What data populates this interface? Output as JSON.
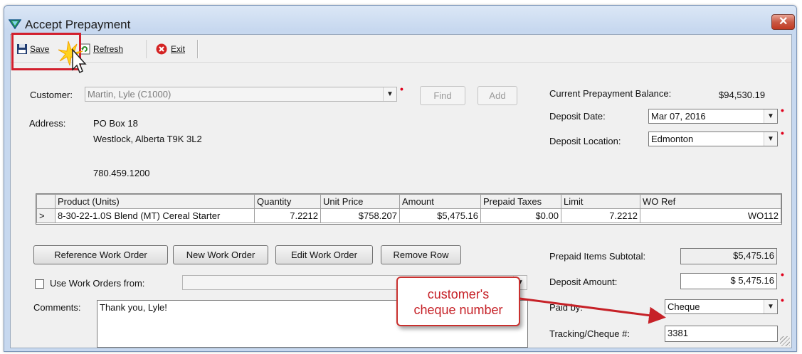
{
  "window": {
    "title": "Accept Prepayment",
    "close_symbol": "✕"
  },
  "toolbar": {
    "save_label": "Save",
    "refresh_label": "Refresh",
    "exit_label": "Exit"
  },
  "customer": {
    "label": "Customer:",
    "value": "Martin, Lyle (C1000)",
    "find_label": "Find",
    "add_label": "Add"
  },
  "address": {
    "label": "Address:",
    "line1": "PO Box 18",
    "line2": "Westlock, Alberta T9K 3L2",
    "phone": "780.459.1200"
  },
  "balance": {
    "label": "Current Prepayment Balance:",
    "value": "$94,530.19"
  },
  "deposit": {
    "date_label": "Deposit Date:",
    "date_value": "Mar 07, 2016",
    "location_label": "Deposit Location:",
    "location_value": "Edmonton"
  },
  "table": {
    "columns": [
      "Product (Units)",
      "Quantity",
      "Unit Price",
      "Amount",
      "Prepaid Taxes",
      "Limit",
      "WO Ref"
    ],
    "rows": [
      {
        "marker": ">",
        "product": "8-30-22-1.0S Blend (MT)  Cereal Starter",
        "quantity": "7.2212",
        "unit_price": "$758.207",
        "amount": "$5,475.16",
        "prepaid_taxes": "$0.00",
        "limit": "7.2212",
        "wo_ref": "WO112"
      }
    ]
  },
  "buttons": {
    "reference_wo": "Reference Work Order",
    "new_wo": "New Work Order",
    "edit_wo": "Edit Work Order",
    "remove_row": "Remove Row"
  },
  "use_wo": {
    "label": "Use Work Orders from:",
    "value": ""
  },
  "comments": {
    "label": "Comments:",
    "value": "Thank you, Lyle!"
  },
  "totals": {
    "subtotal_label": "Prepaid Items Subtotal:",
    "subtotal_value": "$5,475.16",
    "deposit_amount_label": "Deposit Amount:",
    "deposit_amount_value": "$ 5,475.16",
    "paid_by_label": "Paid by:",
    "paid_by_value": "Cheque",
    "tracking_label": "Tracking/Cheque #:",
    "tracking_value": "3381"
  },
  "annotation": {
    "line1": "customer's",
    "line2": "cheque number"
  },
  "colors": {
    "highlight": "#d21f2d",
    "callout_text": "#c62127",
    "required": "#e0001b"
  }
}
